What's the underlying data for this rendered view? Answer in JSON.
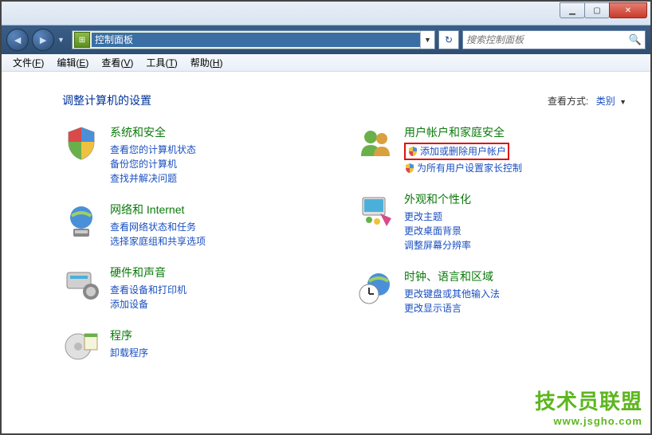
{
  "titlebar": {
    "min": "▁",
    "max": "▢",
    "close": "✕"
  },
  "nav": {
    "address": "控制面板",
    "search_placeholder": "搜索控制面板"
  },
  "menu": {
    "file": "文件",
    "file_u": "F",
    "edit": "编辑",
    "edit_u": "E",
    "view": "查看",
    "view_u": "V",
    "tools": "工具",
    "tools_u": "T",
    "help": "帮助",
    "help_u": "H"
  },
  "heading": "调整计算机的设置",
  "viewby_label": "查看方式:",
  "viewby_value": "类别",
  "cats": {
    "sys": {
      "title": "系统和安全",
      "l1": "查看您的计算机状态",
      "l2": "备份您的计算机",
      "l3": "查找并解决问题"
    },
    "net": {
      "title": "网络和 Internet",
      "l1": "查看网络状态和任务",
      "l2": "选择家庭组和共享选项"
    },
    "hw": {
      "title": "硬件和声音",
      "l1": "查看设备和打印机",
      "l2": "添加设备"
    },
    "prog": {
      "title": "程序",
      "l1": "卸载程序"
    },
    "user": {
      "title": "用户帐户和家庭安全",
      "l1": "添加或删除用户帐户",
      "l2": "为所有用户设置家长控制"
    },
    "appear": {
      "title": "外观和个性化",
      "l1": "更改主题",
      "l2": "更改桌面背景",
      "l3": "调整屏幕分辨率"
    },
    "clock": {
      "title": "时钟、语言和区域",
      "l1": "更改键盘或其他输入法",
      "l2": "更改显示语言"
    }
  },
  "watermark": {
    "text": "技术员联盟",
    "url": "www.jsgho.com"
  }
}
